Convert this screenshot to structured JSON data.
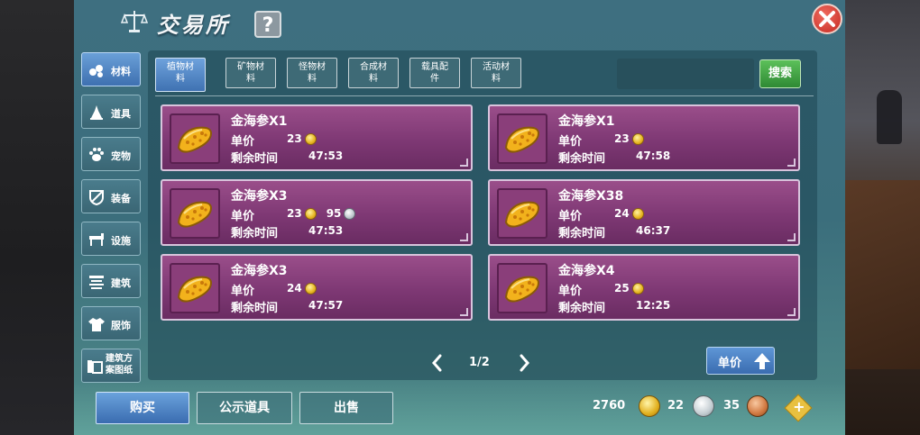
{
  "header": {
    "title": "交易所",
    "help": "?"
  },
  "sidebar": {
    "items": [
      {
        "label": "材料",
        "icon": "materials-icon",
        "active": true
      },
      {
        "label": "道具",
        "icon": "item-icon",
        "active": false
      },
      {
        "label": "宠物",
        "icon": "paw-icon",
        "active": false
      },
      {
        "label": "装备",
        "icon": "equipment-icon",
        "active": false
      },
      {
        "label": "设施",
        "icon": "facility-icon",
        "active": false
      },
      {
        "label": "建筑",
        "icon": "building-icon",
        "active": false
      },
      {
        "label": "服饰",
        "icon": "clothing-icon",
        "active": false
      },
      {
        "label": "建筑方案图纸",
        "line1": "建筑方",
        "line2": "案图纸",
        "icon": "blueprint-icon",
        "active": false
      }
    ]
  },
  "tabs": [
    {
      "line1": "植物材",
      "line2": "料",
      "active": true
    },
    {
      "line1": "矿物材",
      "line2": "料",
      "active": false
    },
    {
      "line1": "怪物材",
      "line2": "料",
      "active": false
    },
    {
      "line1": "合成材",
      "line2": "料",
      "active": false
    },
    {
      "line1": "载具配",
      "line2": "件",
      "active": false
    },
    {
      "line1": "活动材",
      "line2": "料",
      "active": false
    }
  ],
  "search": {
    "value": "",
    "button": "搜索"
  },
  "listings": [
    {
      "name": "金海参X1",
      "price_label": "单价",
      "gold": "23",
      "silver": null,
      "time_label": "剩余时间",
      "time": "47:53"
    },
    {
      "name": "金海参X1",
      "price_label": "单价",
      "gold": "23",
      "silver": null,
      "time_label": "剩余时间",
      "time": "47:58"
    },
    {
      "name": "金海参X3",
      "price_label": "单价",
      "gold": "23",
      "silver": "95",
      "time_label": "剩余时间",
      "time": "47:53"
    },
    {
      "name": "金海参X38",
      "price_label": "单价",
      "gold": "24",
      "silver": null,
      "time_label": "剩余时间",
      "time": "46:37"
    },
    {
      "name": "金海参X3",
      "price_label": "单价",
      "gold": "24",
      "silver": null,
      "time_label": "剩余时间",
      "time": "47:57"
    },
    {
      "name": "金海参X4",
      "price_label": "单价",
      "gold": "25",
      "silver": null,
      "time_label": "剩余时间",
      "time": "12:25"
    }
  ],
  "pager": {
    "page": "1/2"
  },
  "sort": {
    "label": "单价"
  },
  "bottom": {
    "buy": "购买",
    "publicize": "公示道具",
    "sell": "出售"
  },
  "currency": {
    "gold": "2760",
    "silver": "22",
    "bronze": "35"
  }
}
